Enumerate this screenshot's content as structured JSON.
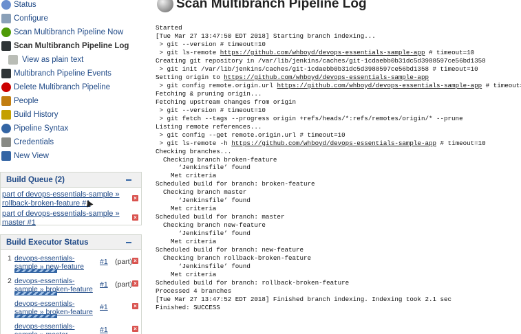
{
  "sidebar": {
    "tasks": [
      {
        "label": "Status",
        "icon": "search-icon",
        "color": "#6a8fcf"
      },
      {
        "label": "Configure",
        "icon": "wrench-icon",
        "color": "#8aa0b8"
      },
      {
        "label": "Scan Multibranch Pipeline Now",
        "icon": "clock-icon",
        "color": "#4e9a06"
      },
      {
        "label": "Scan Multibranch Pipeline Log",
        "icon": "terminal-icon",
        "color": "#2e3436"
      },
      {
        "label": "View as plain text",
        "icon": "document-icon",
        "color": "#babdb6"
      },
      {
        "label": "Multibranch Pipeline Events",
        "icon": "terminal-icon",
        "color": "#2e3436"
      },
      {
        "label": "Delete Multibranch Pipeline",
        "icon": "no-entry-icon",
        "color": "#cc0000"
      },
      {
        "label": "People",
        "icon": "people-icon",
        "color": "#c17d11"
      },
      {
        "label": "Build History",
        "icon": "notepad-icon",
        "color": "#c4a000"
      },
      {
        "label": "Pipeline Syntax",
        "icon": "help-icon",
        "color": "#3465a4"
      },
      {
        "label": "Credentials",
        "icon": "key-icon",
        "color": "#888a85"
      },
      {
        "label": "New View",
        "icon": "folder-icon",
        "color": "#3465a4"
      }
    ]
  },
  "build_queue": {
    "title": "Build Queue (2)",
    "items": [
      {
        "text": "part of devops-essentials-sample » rollback-broken-feature #1"
      },
      {
        "text": "part of devops-essentials-sample » master #1"
      }
    ]
  },
  "executor": {
    "title": "Build Executor Status",
    "rows": [
      {
        "num": "1",
        "name": "devops-essentials-sample » new-feature",
        "build": "#1",
        "part": "(part)"
      },
      {
        "num": "2",
        "name": "devops-essentials-sample » broken-feature",
        "build": "#1",
        "part": "(part)"
      },
      {
        "num": "",
        "name": "devops-essentials-sample » broken-feature",
        "build": "#1",
        "part": ""
      },
      {
        "num": "",
        "name": "devops-essentials-sample » master",
        "build": "#1",
        "part": ""
      }
    ]
  },
  "main": {
    "title": "Scan Multibranch Pipeline Log",
    "log_lines": [
      [
        {
          "t": "Started"
        }
      ],
      [
        {
          "t": "[Tue Mar 27 13:47:50 EDT 2018] Starting branch indexing..."
        }
      ],
      [
        {
          "t": " > git --version # timeout=10"
        }
      ],
      [
        {
          "t": " > git ls-remote "
        },
        {
          "t": "https://github.com/whboyd/devops-essentials-sample-app",
          "link": true
        },
        {
          "t": " # timeout=10"
        }
      ],
      [
        {
          "t": "Creating git repository in /var/lib/jenkins/caches/git-1cdaebb0b31dc5d3988597ce56bd1358"
        }
      ],
      [
        {
          "t": " > git init /var/lib/jenkins/caches/git-1cdaebb0b31dc5d3988597ce56bd1358 # timeout=10"
        }
      ],
      [
        {
          "t": "Setting origin to "
        },
        {
          "t": "https://github.com/whboyd/devops-essentials-sample-app",
          "link": true
        }
      ],
      [
        {
          "t": " > git config remote.origin.url "
        },
        {
          "t": "https://github.com/whboyd/devops-essentials-sample-app",
          "link": true
        },
        {
          "t": " # timeout=10"
        }
      ],
      [
        {
          "t": "Fetching & pruning origin..."
        }
      ],
      [
        {
          "t": "Fetching upstream changes from origin"
        }
      ],
      [
        {
          "t": " > git --version # timeout=10"
        }
      ],
      [
        {
          "t": " > git fetch --tags --progress origin +refs/heads/*:refs/remotes/origin/* --prune"
        }
      ],
      [
        {
          "t": "Listing remote references..."
        }
      ],
      [
        {
          "t": " > git config --get remote.origin.url # timeout=10"
        }
      ],
      [
        {
          "t": " > git ls-remote -h "
        },
        {
          "t": "https://github.com/whboyd/devops-essentials-sample-app",
          "link": true
        },
        {
          "t": " # timeout=10"
        }
      ],
      [
        {
          "t": "Checking branches..."
        }
      ],
      [
        {
          "t": "  Checking branch broken-feature"
        }
      ],
      [
        {
          "t": "      ‘Jenkinsfile’ found"
        }
      ],
      [
        {
          "t": "    Met criteria"
        }
      ],
      [
        {
          "t": "Scheduled build for branch: broken-feature"
        }
      ],
      [
        {
          "t": "  Checking branch master"
        }
      ],
      [
        {
          "t": "      ‘Jenkinsfile’ found"
        }
      ],
      [
        {
          "t": "    Met criteria"
        }
      ],
      [
        {
          "t": "Scheduled build for branch: master"
        }
      ],
      [
        {
          "t": "  Checking branch new-feature"
        }
      ],
      [
        {
          "t": "      ‘Jenkinsfile’ found"
        }
      ],
      [
        {
          "t": "    Met criteria"
        }
      ],
      [
        {
          "t": "Scheduled build for branch: new-feature"
        }
      ],
      [
        {
          "t": "  Checking branch rollback-broken-feature"
        }
      ],
      [
        {
          "t": "      ‘Jenkinsfile’ found"
        }
      ],
      [
        {
          "t": "    Met criteria"
        }
      ],
      [
        {
          "t": "Scheduled build for branch: rollback-broken-feature"
        }
      ],
      [
        {
          "t": "Processed 4 branches"
        }
      ],
      [
        {
          "t": "[Tue Mar 27 13:47:52 EDT 2018] Finished branch indexing. Indexing took 2.1 sec"
        }
      ],
      [
        {
          "t": "Finished: SUCCESS"
        }
      ]
    ]
  }
}
